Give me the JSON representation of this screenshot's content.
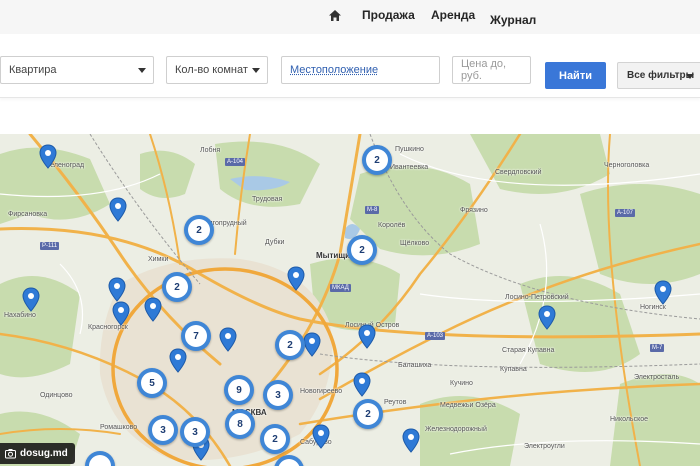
{
  "nav": {
    "home_icon": "home-icon",
    "links": [
      "Продажа",
      "Аренда",
      "Журнал"
    ]
  },
  "filters": {
    "property_type": "Квартира",
    "rooms": "Кол-во комнат",
    "location": "Местоположение",
    "price_placeholder": "Цена до, руб.",
    "search_label": "Найти",
    "all_filters_label": "Все фильтры"
  },
  "map": {
    "places": [
      "Лобня",
      "Зеленоград",
      "Фирсановка",
      "Химки",
      "Долгопрудный",
      "Мытищи",
      "Ивантеевка",
      "Пушкино",
      "Щёлково",
      "Королёв",
      "Фрязино",
      "Черноголовка",
      "Красногорск",
      "Нахабино",
      "Лосино-Петровский",
      "Ногинск",
      "Балашиха",
      "Старая Купавна",
      "Реутов",
      "Железнодорожный",
      "Электросталь",
      "Электроугли",
      "МОСКВА",
      "Новогиреево",
      "Медвежьи Озёра",
      "Свердловский",
      "Никольское",
      "Сабурово",
      "Ромашково",
      "Одинцово",
      "Лосиный Остров",
      "Трудовая",
      "Кучино",
      "Дубки",
      "Купавна"
    ],
    "clusters": [
      "2",
      "2",
      "2",
      "2",
      "7",
      "2",
      "5",
      "9",
      "3",
      "3",
      "8",
      "3",
      "2",
      "2"
    ]
  },
  "watermark": "dosug.md"
}
